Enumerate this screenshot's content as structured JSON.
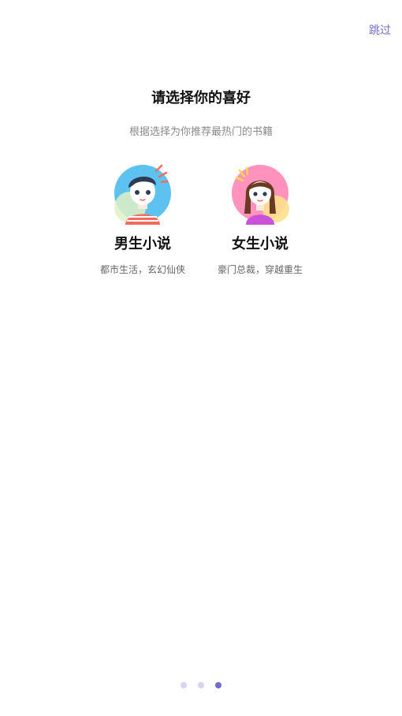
{
  "header": {
    "skip_label": "跳过"
  },
  "main": {
    "title": "请选择你的喜好",
    "subtitle": "根据选择为你推荐最热门的书籍",
    "options": [
      {
        "icon": "boy-avatar-icon",
        "title": "男生小说",
        "desc": "都市生活，玄幻仙侠"
      },
      {
        "icon": "girl-avatar-icon",
        "title": "女生小说",
        "desc": "豪门总裁，穿越重生"
      }
    ]
  },
  "pager": {
    "count": 3,
    "active": 3
  },
  "colors": {
    "accent": "#6f6bd0",
    "dot_inactive": "#d6d4ef",
    "dot_active": "#6f6bd0"
  }
}
